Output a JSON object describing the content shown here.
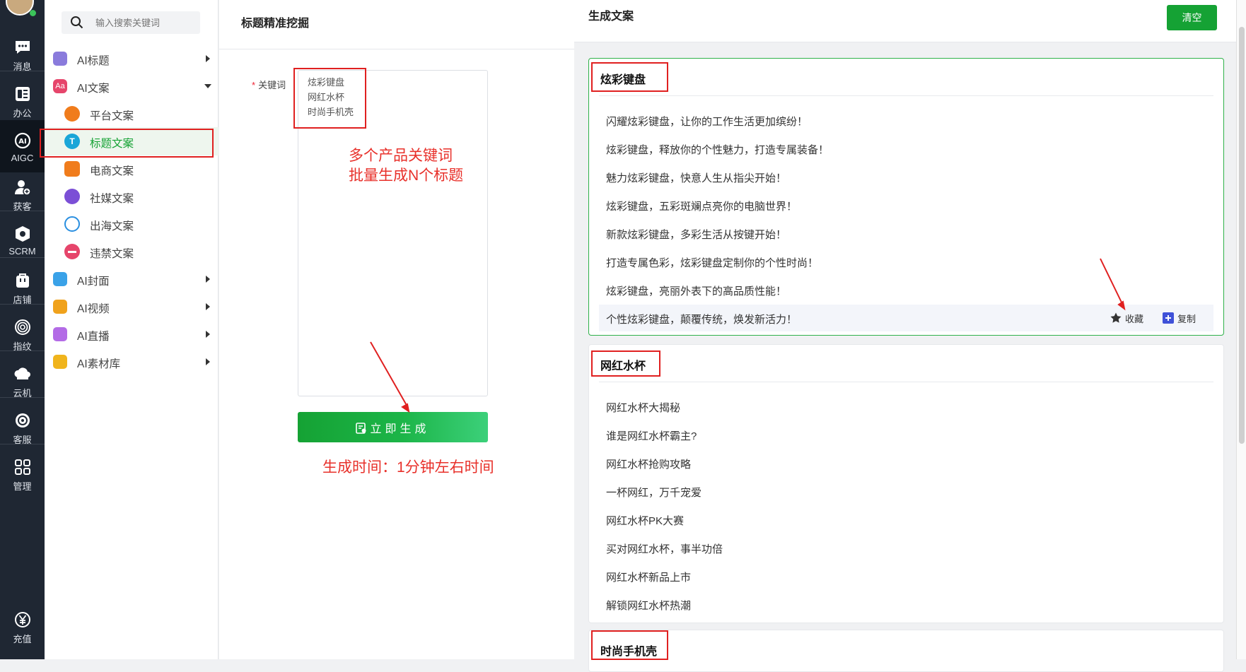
{
  "rail": {
    "items": [
      {
        "label": "消息",
        "icon": "message-icon"
      },
      {
        "label": "办公",
        "icon": "office-icon"
      },
      {
        "label": "AIGC",
        "icon": "aigc-icon"
      },
      {
        "label": "获客",
        "icon": "user-add-icon"
      },
      {
        "label": "SCRM",
        "icon": "scrm-icon"
      },
      {
        "label": "店铺",
        "icon": "shop-icon"
      },
      {
        "label": "指纹",
        "icon": "fingerprint-icon"
      },
      {
        "label": "云机",
        "icon": "cloud-phone-icon"
      },
      {
        "label": "客服",
        "icon": "service-icon"
      },
      {
        "label": "管理",
        "icon": "grid-icon"
      }
    ],
    "recharge": "充值"
  },
  "nav": {
    "search_placeholder": "输入搜索关键词",
    "groups": [
      {
        "label": "AI标题",
        "color": "#8a7bdc"
      },
      {
        "label": "AI文案",
        "color": "#e6456b"
      }
    ],
    "sub_items": [
      {
        "label": "平台文案",
        "color": "#f07c1c"
      },
      {
        "label": "标题文案",
        "color": "#1aa6d8"
      },
      {
        "label": "电商文案",
        "color": "#f07c1c"
      },
      {
        "label": "社媒文案",
        "color": "#7b4fd6"
      },
      {
        "label": "出海文案",
        "color": "#2a8fe0"
      },
      {
        "label": "违禁文案",
        "color": "#e6456b"
      }
    ],
    "more_groups": [
      {
        "label": "AI封面",
        "color": "#3aa2e8"
      },
      {
        "label": "AI视频",
        "color": "#f0a21c"
      },
      {
        "label": "AI直播",
        "color": "#b36be6"
      },
      {
        "label": "AI素材库",
        "color": "#f0b41c"
      }
    ]
  },
  "form": {
    "title": "标题精准挖掘",
    "keyword_label": "关键词",
    "required_mark": "*",
    "keywords": [
      "炫彩键盘",
      "网红水杯",
      "时尚手机壳"
    ],
    "generate_label": "立即生成",
    "annotation_1": "多个产品关键词",
    "annotation_2": "批量生成N个标题",
    "annotation_3": "生成时间：1分钟左右时间"
  },
  "results": {
    "title": "生成文案",
    "clear_label": "清空",
    "favorite_label": "收藏",
    "copy_label": "复制",
    "accent": "#15a234",
    "cards": [
      {
        "title": "炫彩键盘",
        "lines": [
          "闪耀炫彩键盘，让你的工作生活更加缤纷！",
          "炫彩键盘，释放你的个性魅力，打造专属装备！",
          "魅力炫彩键盘，快意人生从指尖开始！",
          "炫彩键盘，五彩斑斓点亮你的电脑世界！",
          "新款炫彩键盘，多彩生活从按键开始！",
          "打造专属色彩，炫彩键盘定制你的个性时尚！",
          "炫彩键盘，亮丽外表下的高品质性能！",
          "个性炫彩键盘，颠覆传统，焕发新活力！"
        ]
      },
      {
        "title": "网红水杯",
        "lines": [
          "网红水杯大揭秘",
          "谁是网红水杯霸主?",
          "网红水杯抢购攻略",
          "一杯网红，万千宠爱",
          "网红水杯PK大赛",
          "买对网红水杯，事半功倍",
          "网红水杯新品上市",
          "解锁网红水杯热潮"
        ]
      },
      {
        "title": "时尚手机壳",
        "lines": []
      }
    ]
  }
}
